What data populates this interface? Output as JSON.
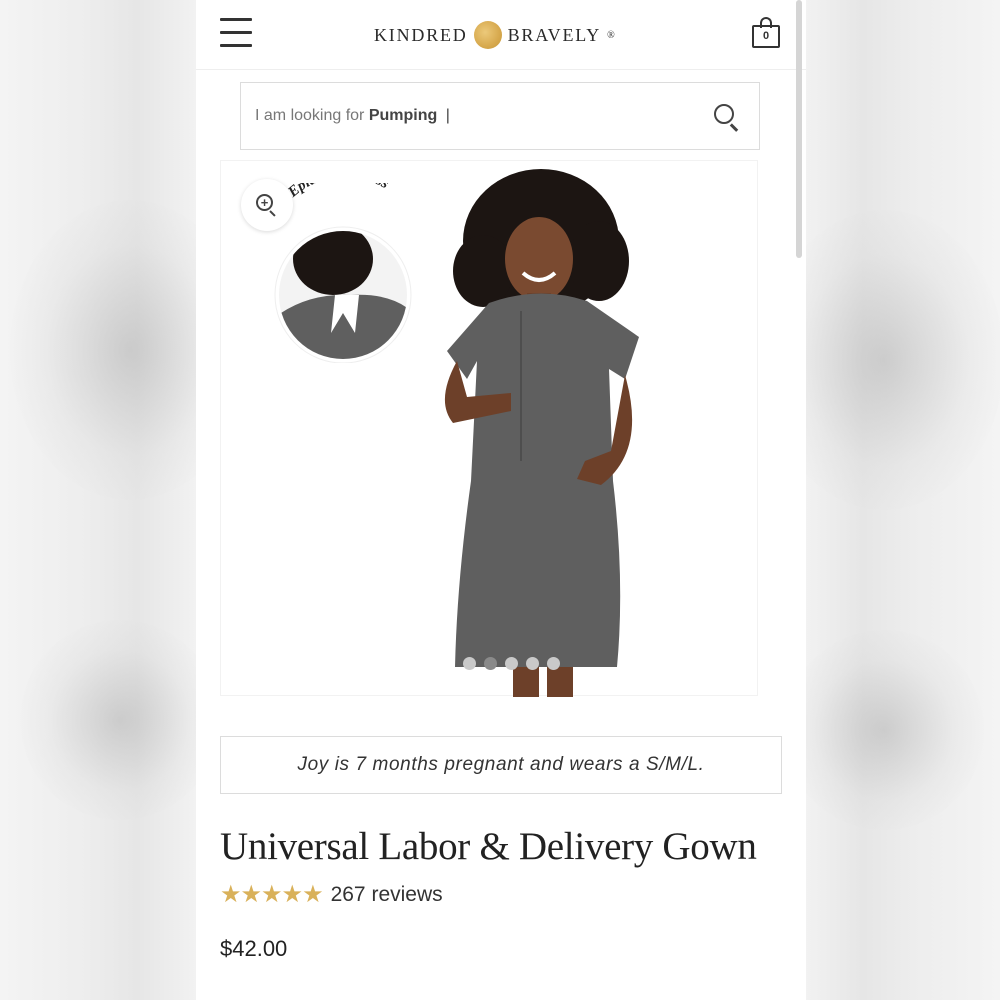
{
  "header": {
    "logo_left": "KINDRED",
    "logo_right": "BRAVELY",
    "logo_mark": "®",
    "cart_count": "0"
  },
  "search": {
    "prefix": "I am looking for",
    "term": "Pumping",
    "caret": "|"
  },
  "gallery": {
    "badge_text": "Epidural Access",
    "slide_count": 5,
    "active_slide": 1
  },
  "product": {
    "model_note": "Joy is 7 months pregnant and wears a S/M/L.",
    "title": "Universal Labor & Delivery Gown",
    "stars": "★★★★★",
    "reviews": "267 reviews",
    "price": "$42.00"
  },
  "colors": {
    "accent_gold": "#d9b15a",
    "text_dark": "#222222",
    "border": "#dcdcdc"
  }
}
